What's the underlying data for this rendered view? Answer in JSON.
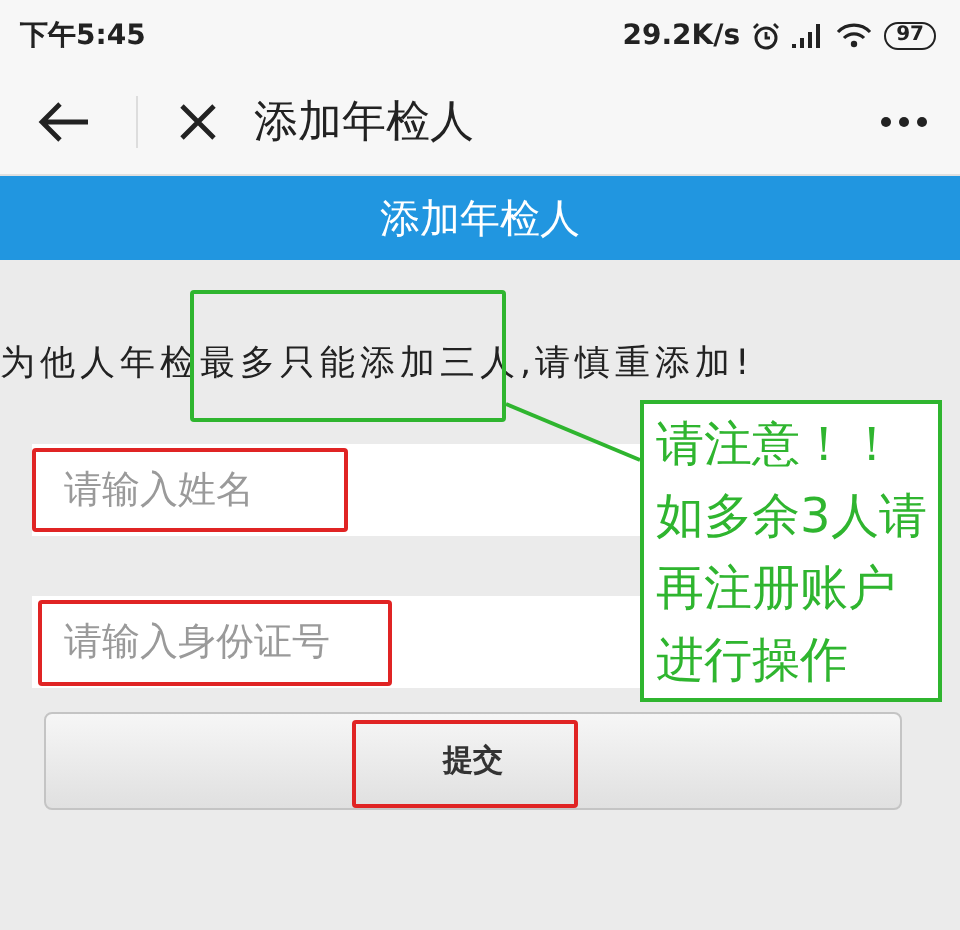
{
  "status_bar": {
    "time": "下午5:45",
    "network_speed": "29.2K/s",
    "battery": "97"
  },
  "nav_bar": {
    "title": "添加年检人"
  },
  "header": {
    "title": "添加年检人"
  },
  "notice": "为他人年检最多只能添加三人,请慎重添加!",
  "fields": [
    {
      "placeholder": "请输入姓名"
    },
    {
      "placeholder": "请输入身份证号"
    }
  ],
  "submit_button": {
    "label": "提交"
  },
  "annotations": {
    "highlights": [
      {
        "color": "#2fb52f"
      },
      {
        "color": "#e02424"
      },
      {
        "color": "#e02424"
      },
      {
        "color": "#e02424"
      }
    ],
    "callout": {
      "color": "#2fb52f",
      "lines": [
        "请注意！！",
        "如多余3人请",
        "再注册账户",
        "进行操作"
      ]
    }
  }
}
